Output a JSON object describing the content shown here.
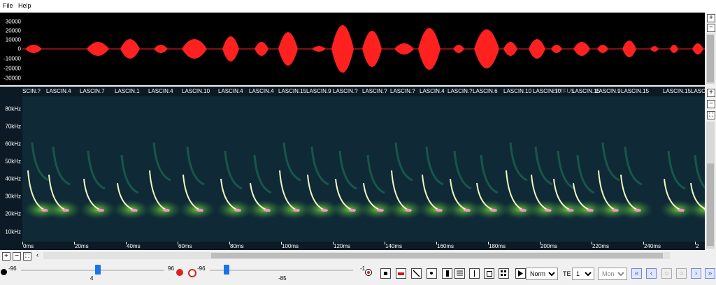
{
  "menu": [
    "File",
    "Help"
  ],
  "waveform": {
    "y_ticks": [
      "30000",
      "20000",
      "10000",
      "0",
      "-10000",
      "-20000",
      "-30000"
    ],
    "color": "#ff2020"
  },
  "spectrogram": {
    "freq_ticks": [
      "80kHz",
      "70kHz",
      "60kHz",
      "50kHz",
      "40kHz",
      "30kHz",
      "20kHz",
      "10kHz"
    ],
    "labels": [
      "SCIN.?",
      "LASCIN.4",
      "LASCIN.7",
      "LASCIN.1",
      "LASCIN.4",
      "LASCIN.10",
      "LASCIN.4",
      "LASCIN.4",
      "LASCIN.15",
      "LASCIN.9",
      "LASCIN.?",
      "LASCIN.?",
      "LASCIN.?",
      "LASCIN.4",
      "LASCIN.?",
      "LASCIN.6",
      "LASCIN.10",
      "LASCIN.10",
      "EPTFUS",
      "LASCIN.15",
      "LASCIN.9",
      "LASCIN.15",
      "LASCIN.15",
      "LASCIN.15"
    ],
    "time_ticks": [
      "0ms",
      "20ms",
      "40ms",
      "60ms",
      "80ms",
      "100ms",
      "120ms",
      "140ms",
      "160ms",
      "180ms",
      "200ms",
      "220ms",
      "240ms",
      "2"
    ]
  },
  "controls": {
    "slider1": {
      "min": "-96",
      "max": "96",
      "value": "4",
      "level": 0.535
    },
    "slider2": {
      "min": "-96",
      "max": "-1",
      "value": "-85",
      "level": 0.115
    },
    "mode": "Normal",
    "te_label": "TE",
    "te_value": "1",
    "channel": "Mono"
  }
}
